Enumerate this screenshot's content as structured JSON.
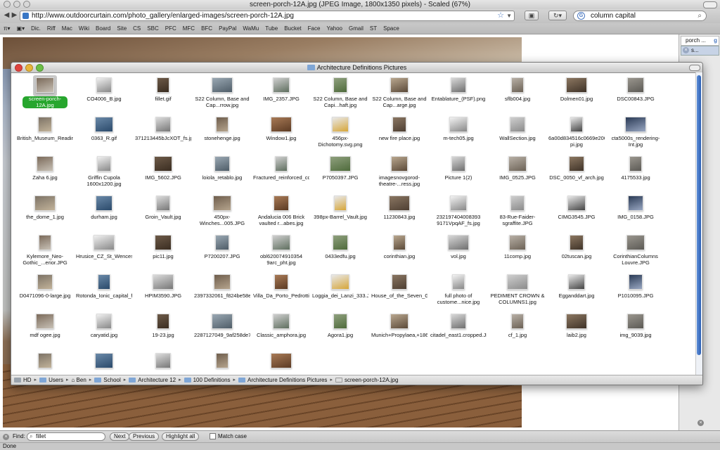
{
  "browser": {
    "title": "screen-porch-12A.jpg (JPEG Image, 1800x1350 pixels) - Scaled (67%)",
    "url": "http://www.outdoorcurtain.com/photo_gallery/enlarged-images/screen-porch-12A.jpg",
    "search_value": "column capital",
    "bookmarks": [
      "Dic.",
      "Riff",
      "Mac",
      "Wiki",
      "Board",
      "Site",
      "CS",
      "SBC",
      "PFC",
      "MFC",
      "BFC",
      "PayPal",
      "WaMu",
      "Tube",
      "Bucket",
      "Face",
      "Yahoo",
      "Gmail",
      "ST",
      "Space"
    ],
    "sidebar_tab_title": "porch ...",
    "sidebar_tab_item": "s...",
    "status": "Done"
  },
  "finder": {
    "title": "Architecture Definitions Pictures",
    "items": [
      "screen-porch-12A.jpg",
      "CO4006_B.jpg",
      "fillet.gif",
      "S22 Column, Base and Cap...rrow.jpg",
      "IMG_2357.JPG",
      "S22 Column, Base and Capi...haft.jpg",
      "S22 Column, Base and Cap...arge.jpg",
      "Entablature_(PSF).png",
      "sflb004.jpg",
      "Dolmen01.jpg",
      "DSC00843.JPG",
      "British_Museum_Reading_R...006.jpg",
      "0363_R.gif",
      "371213445bJcXOT_fs.jpg",
      "stonehenge.jpg",
      "Window1.jpg",
      "456px-Dichotomy.svg.png",
      "new fire place.jpg",
      "m-tech05.jpg",
      "WallSection.jpg",
      "6a00d834516c0669e200e...4-pi.jpg",
      "cta5000s_rendering-Int.jpg",
      "Zaha 6.jpg",
      "Griffin Cupola 1600x1200.jpg",
      "IMG_5602.JPG",
      "loiola_retablo.jpg",
      "Fractured_reinforced_concr...umn.JPG",
      "P7050397.JPG",
      "imagesnovgorod-theatre-...ress.jpg",
      "Picture 1(2)",
      "IMG_0525.JPG",
      "DSC_0050_vf_arch.jpg",
      "4175533.jpg",
      "the_dome_1.jpg",
      "durham.jpg",
      "Groin_Vault.jpg",
      "450px-Winches...005.JPG",
      "Andalucia 006 Brick vaulted r...abes.jpg",
      "398px-Barrel_Vault.jpg",
      "11230843.jpg",
      "232197404008393 9171VpqAF_fs.jpg",
      "83-Rue-Faider-sgraffite.JPG",
      "CIMG3545.JPG",
      "IMG_0158.JPG",
      "Kylemore_Neo-Gothic_...erior.JPG",
      "Hrusice_CZ_St_Wenceslas_c....148.jpg",
      "pic11.jpg",
      "P7200207.JPG",
      "obl620074910354 9arc_pht.jpg",
      "0433edfu.jpg",
      "corinthian.jpg",
      "vol.jpg",
      "11comp.jpg",
      "02tuscan.jpg",
      "CorinthianColumns Louvre.JPG",
      "D0471096-0-large.jpg",
      "Rotonda_Ionic_capital_fr.jpg",
      "HPIM3590.JPG",
      "2397332061_f824be58ec_o.jpg",
      "Villa_Da_Porto_Pedrotti1.JPG",
      "Loggia_dei_Lanzi_333.JPG",
      "House_of_the_Seven_Gable...etts.JPG",
      "full photo of custome...nice.jpg",
      "PEDIMENT CROWN & COLUMNS1.jpg",
      "Egganddart.jpg",
      "P1010095.JPG",
      "mdf ogee.jpg",
      "caryatid.jpg",
      "19-23.jpg",
      "2287127049_9af258de72_o.jpg",
      "Classic_amphora.jpg",
      "Agora1.jpg",
      "Munich+Propylaea,+1862.jpg",
      "citadel_east1.cropped.JPG",
      "cf_1.jpg",
      "laib2.jpg",
      "img_9039.jpg",
      "",
      "",
      "",
      "",
      ""
    ],
    "path": [
      "HD",
      "Users",
      "Ben",
      "School",
      "Architecture 12",
      "100 Definitions",
      "Architecture Definitions Pictures",
      "screen-porch-12A.jpg"
    ]
  },
  "find": {
    "label": "Find:",
    "value": "fillet",
    "next": "Next",
    "previous": "Previous",
    "highlight": "Highlight all",
    "match_case": "Match case"
  }
}
